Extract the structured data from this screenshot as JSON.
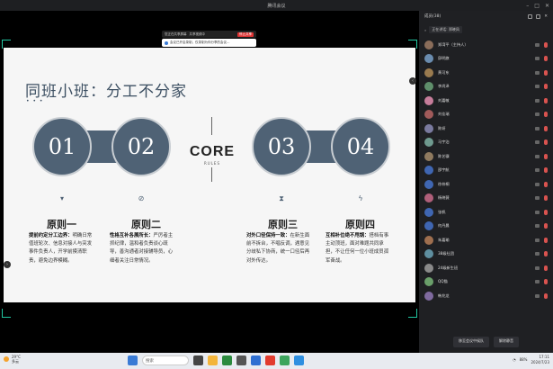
{
  "window": {
    "title": "腾讯会议"
  },
  "stage": {
    "toolbar": {
      "text1": "您正在共享屏幕",
      "text2": "共享视频中",
      "record_label": "停止共享"
    },
    "notice": {
      "text": "会议已开启录制，仅录制为你分享的会议…"
    }
  },
  "slide": {
    "title": "同班小班：分工不分家",
    "dots": "• • •",
    "core": "CORE",
    "rules": "RULES",
    "numbers": [
      "01",
      "02",
      "03",
      "04"
    ],
    "principles": [
      {
        "title": "原则一",
        "lead": "提前约定分工边界：",
        "body": "明确日常值班轮次、信息对接人与突发事件负责人，开学前摸清职责，避免边界模糊。"
      },
      {
        "title": "原则二",
        "lead": "性格互补各展所长：",
        "body": "严厉者主抓纪律，温和者负责谈心疏导，善沟通者对接辅导员，心细者关注日常情况。"
      },
      {
        "title": "原则三",
        "lead": "对外口径保持一致：",
        "body": "在新生面前不拆台，不唱反调，遇意见分歧私下协商，统一口径后再对外传达。"
      },
      {
        "title": "原则四",
        "lead": "互相补位绝不甩锅：",
        "body": "搭档有事主动顶班，面对难题共同承担，不让任何一位小班成员孤军奋战。"
      }
    ]
  },
  "panel": {
    "tab_label": "成员(38)",
    "speaking_label": "正在讲话:",
    "speaking_name": "郑晓凤",
    "participants": [
      {
        "name": "郑湾平（主持人）",
        "color": "#8a6d5a"
      },
      {
        "name": "邱明旗",
        "color": "#6a8caf"
      },
      {
        "name": "黄可东",
        "color": "#9a7b4f"
      },
      {
        "name": "李尚泽",
        "color": "#5f8f6b"
      },
      {
        "name": "刘嘉敏",
        "color": "#c77d9b"
      },
      {
        "name": "刘佳瑞",
        "color": "#a05a5a"
      },
      {
        "name": "陈妍",
        "color": "#7a7a9f"
      },
      {
        "name": "马宇泊",
        "color": "#6f9a8f"
      },
      {
        "name": "陈艺骥",
        "color": "#8f7a5f"
      },
      {
        "name": "邵宇航",
        "color": "#3f66b2"
      },
      {
        "name": "徐梓桐",
        "color": "#3f66b2"
      },
      {
        "name": "杨晓薇",
        "color": "#b05f7a"
      },
      {
        "name": "张帆",
        "color": "#3f66b2"
      },
      {
        "name": "何丹晨",
        "color": "#3f66b2"
      },
      {
        "name": "朱嘉瑜",
        "color": "#9f6f4f"
      },
      {
        "name": "38级社团",
        "color": "#5f8fa0"
      },
      {
        "name": "24级新生班",
        "color": "#8a8a8a"
      },
      {
        "name": "QQ猫",
        "color": "#6a9f6a"
      },
      {
        "name": "韩兆龙",
        "color": "#7f6a9f"
      }
    ],
    "buttons": [
      "移至会议中候队",
      "解除静音"
    ]
  },
  "taskbar": {
    "weather_temp": "29°C",
    "weather_desc": "多云",
    "search_placeholder": "搜索",
    "battery": "88%",
    "time": "17:11",
    "date": "2024/7/23"
  }
}
